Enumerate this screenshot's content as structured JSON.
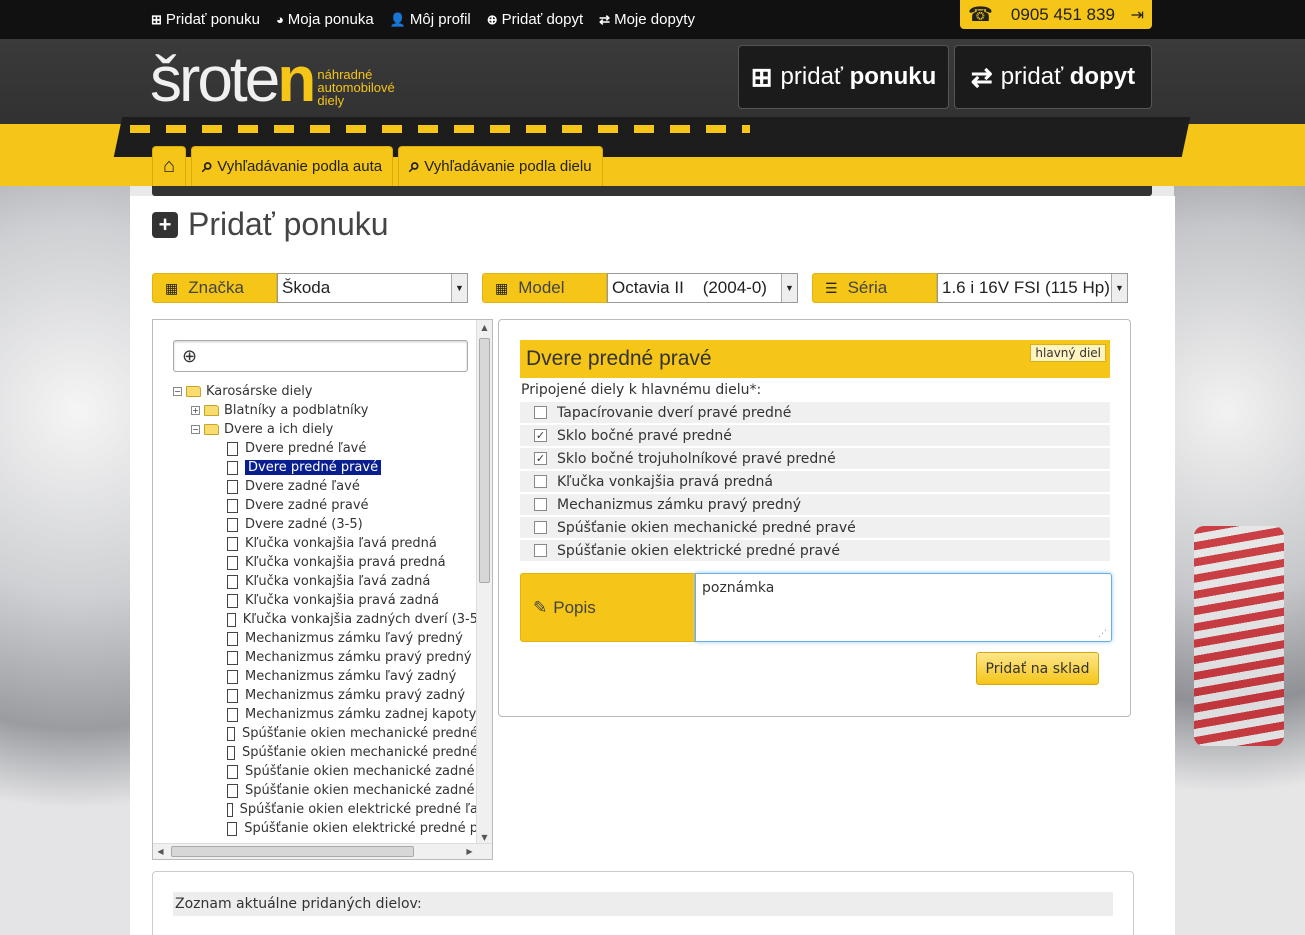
{
  "topnav": {
    "items": [
      {
        "icon": "plus-square-icon",
        "label": "Pridať ponuku"
      },
      {
        "icon": "dashboard-icon",
        "label": "Moja ponuka"
      },
      {
        "icon": "user-icon",
        "label": "Môj profil"
      },
      {
        "icon": "plus-circle-icon",
        "label": "Pridať dopyt"
      },
      {
        "icon": "retweet-icon",
        "label": "Moje dopyty"
      }
    ],
    "phone": "0905 451 839"
  },
  "header": {
    "logo_word_start": "šrote",
    "logo_word_end": "n",
    "logo_tagline": [
      "náhradné",
      "automobilové",
      "diely"
    ],
    "btn_ponuku": {
      "prefix": "pridať",
      "bold": "ponuku"
    },
    "btn_dopyt": {
      "prefix": "pridať",
      "bold": "dopyt"
    },
    "tabs": [
      "Vyhľadávanie podla auta",
      "Vyhľadávanie podla dielu"
    ]
  },
  "page": {
    "title": "Pridať ponuku"
  },
  "selectors": {
    "brand": {
      "label": "Značka",
      "value": "Škoda"
    },
    "model": {
      "label": "Model",
      "value": "Octavia II    (2004-0)"
    },
    "series": {
      "label": "Séria",
      "value": "1.6 i 16V FSI (115 Hp)"
    }
  },
  "tree": {
    "root": "Karosárske diely",
    "level1": [
      "Blatníky a podblatníky",
      "Dvere a ich diely"
    ],
    "items": [
      "Dvere predné ľavé",
      "Dvere predné pravé",
      "Dvere zadné ľavé",
      "Dvere zadné pravé",
      "Dvere zadné (3-5)",
      "Kľučka vonkajšia ľavá predná",
      "Kľučka vonkajšia pravá predná",
      "Kľučka vonkajšia ľavá zadná",
      "Kľučka vonkajšia pravá zadná",
      "Kľučka vonkajšia zadných dverí (3-5",
      "Mechanizmus zámku ľavý predný",
      "Mechanizmus zámku pravý predný",
      "Mechanizmus zámku ľavý zadný",
      "Mechanizmus zámku pravý zadný",
      "Mechanizmus zámku zadnej kapoty",
      "Spúšťanie okien mechanické predné",
      "Spúšťanie okien mechanické predné",
      "Spúšťanie okien mechanické zadné",
      "Spúšťanie okien mechanické zadné",
      "Spúšťanie okien elektrické predné ľa",
      "Spúšťanie okien elektrické predné p"
    ],
    "selected_index": 1
  },
  "part": {
    "title": "Dvere predné pravé",
    "badge": "hlavný diel",
    "attached_label": "Pripojené diely k hlavnému dielu*:",
    "attached": [
      {
        "label": "Tapacírovanie dverí pravé predné",
        "checked": false
      },
      {
        "label": "Sklo bočné pravé predné",
        "checked": true
      },
      {
        "label": "Sklo bočné trojuholníkové pravé predné",
        "checked": true
      },
      {
        "label": "Kľučka vonkajšia pravá predná",
        "checked": false
      },
      {
        "label": "Mechanizmus zámku pravý predný",
        "checked": false
      },
      {
        "label": "Spúšťanie okien mechanické predné pravé",
        "checked": false
      },
      {
        "label": "Spúšťanie okien elektrické predné pravé",
        "checked": false
      }
    ],
    "popis_label": "Popis",
    "popis_value": "poznámka",
    "add_button": "Pridať na sklad"
  },
  "list": {
    "title": "Zoznam aktuálne pridaných dielov:"
  },
  "colors": {
    "accent": "#f5c518",
    "dark": "#111111",
    "selection": "#0a1f8f"
  }
}
